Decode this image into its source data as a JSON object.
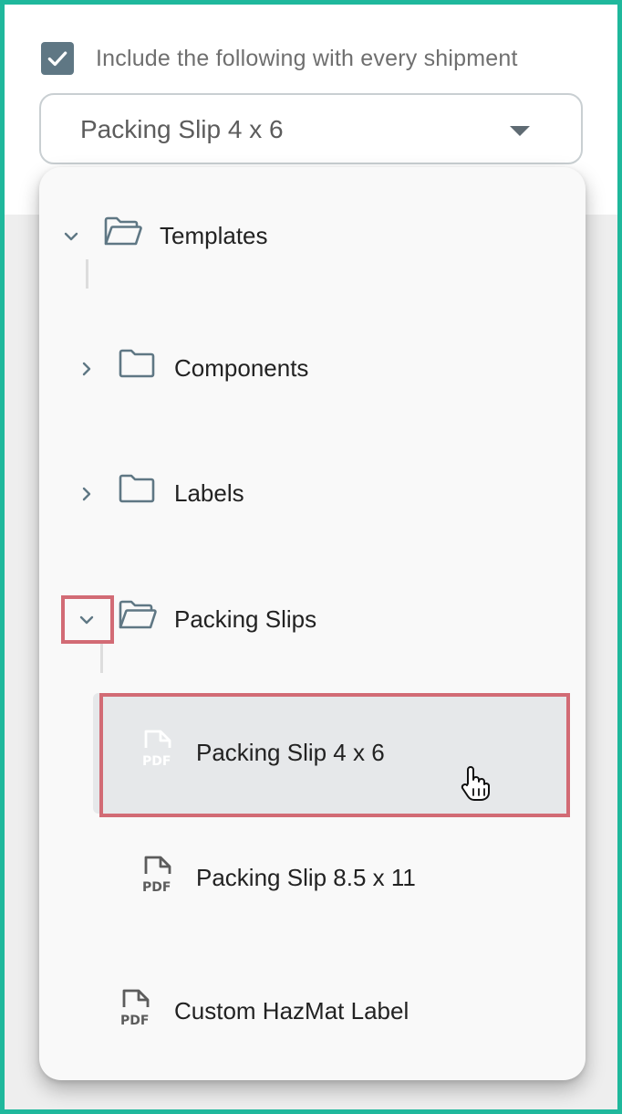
{
  "settings": {
    "include_checked": true,
    "include_label": "Include the following with every shipment"
  },
  "select": {
    "value": "Packing Slip 4 x 6"
  },
  "tree": {
    "root": {
      "label": "Templates",
      "expanded": true
    },
    "folders": [
      {
        "label": "Components",
        "expanded": false
      },
      {
        "label": "Labels",
        "expanded": false
      },
      {
        "label": "Packing Slips",
        "expanded": true
      }
    ],
    "files": [
      {
        "label": "Packing Slip 4 x 6",
        "selected": true,
        "icon": "pdf-file-icon",
        "badge": "PDF"
      },
      {
        "label": "Packing Slip 8.5 x 11",
        "selected": false,
        "icon": "pdf-file-icon",
        "badge": "PDF"
      },
      {
        "label": "Custom HazMat Label",
        "selected": false,
        "icon": "pdf-file-icon",
        "badge": "PDF"
      }
    ]
  },
  "colors": {
    "frame_border": "#1fb89c",
    "checkbox": "#5f7784",
    "icon": "#5f7784",
    "highlight_box": "#d26b75",
    "selected_row": "#e6e8ea"
  }
}
